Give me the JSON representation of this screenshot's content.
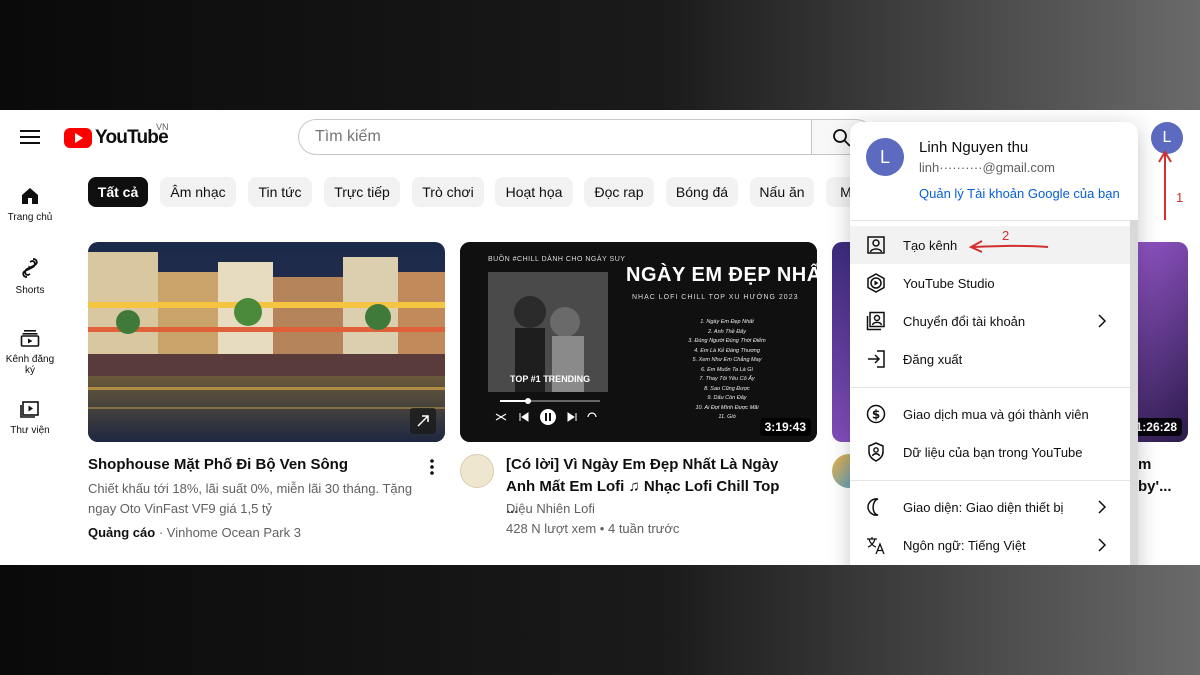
{
  "header": {
    "logo_text": "YouTube",
    "region": "VN",
    "search_placeholder": "Tìm kiếm",
    "avatar_letter": "L"
  },
  "sidebar": {
    "items": [
      {
        "label": "Trang chủ",
        "icon": "home-icon"
      },
      {
        "label": "Shorts",
        "icon": "shorts-icon"
      },
      {
        "label": "Kênh đăng ký",
        "icon": "subscriptions-icon"
      },
      {
        "label": "Thư viện",
        "icon": "library-icon"
      }
    ]
  },
  "chips": [
    "Tất cả",
    "Âm nhạc",
    "Tin tức",
    "Trực tiếp",
    "Trò chơi",
    "Hoạt họa",
    "Đọc rap",
    "Bóng đá",
    "Nấu ăn",
    "M"
  ],
  "videos": [
    {
      "title": "Shophouse Mặt Phố Đi Bộ Ven Sông",
      "desc": "Chiết khấu tới 18%, lãi suất 0%, miễn lãi 30 tháng. Tặng ngay Oto VinFast VF9 giá 1,5 tỷ",
      "ad_label": "Quảng cáo",
      "channel": "Vinhome Ocean Park 3"
    },
    {
      "title": "[Có lời] Vì Ngày Em Đẹp Nhất Là Ngày Anh Mất Em Lofi ♫ Nhạc Lofi Chill Top ...",
      "channel": "Diệu Nhiên Lofi",
      "meta": "428 N lượt xem • 4 tuần trước",
      "duration": "3:19:43",
      "thumb": {
        "caption": "BUỒN #CHILL DÀNH CHO NGÀY SUY",
        "headline": "NGÀY EM ĐẸP NHẤT",
        "subline": "NHẠC LOFI CHILL TOP XU HƯỚNG 2023",
        "badge": "TOP #1 TRENDING",
        "tracklist": [
          "1. Ngày Em Đẹp Nhất",
          "2. Anh Thề Đấy",
          "3. Đúng Người Đúng Thời Điểm",
          "4. Em Là Kẻ Đáng Thương",
          "5. Xem Như Em Chẳng May",
          "6. Em Muốn Ta Là Gì",
          "7. Thay Tôi Yêu Cô Ấy",
          "8. Sao Cũng Được",
          "9. Dấu Còn Đây",
          "10. Ai Đợi Mình Được Mãi",
          "11. Gió"
        ]
      }
    },
    {
      "title_fragment": "m",
      "meta_fragment": "by'...",
      "duration": "1:26:28"
    }
  ],
  "dropdown": {
    "name": "Linh Nguyen thu",
    "email": "linh··········@gmail.com",
    "manage_link": "Quản lý Tài khoản Google của bạn",
    "avatar_letter": "L",
    "items": [
      {
        "label": "Tạo kênh",
        "icon": "create-channel-icon"
      },
      {
        "label": "YouTube Studio",
        "icon": "studio-icon"
      },
      {
        "label": "Chuyển đổi tài khoản",
        "icon": "switch-account-icon"
      },
      {
        "label": "Đăng xuất",
        "icon": "sign-out-icon"
      },
      {
        "label": "Giao dịch mua và gói thành viên",
        "icon": "purchases-icon"
      },
      {
        "label": "Dữ liệu của bạn trong YouTube",
        "icon": "your-data-icon"
      },
      {
        "label": "Giao diện: Giao diện thiết bị",
        "icon": "appearance-icon"
      },
      {
        "label": "Ngôn ngữ: Tiếng Việt",
        "icon": "language-icon"
      }
    ]
  },
  "annotations": {
    "step1": "1",
    "step2": "2",
    "color": "#d32f2f"
  },
  "colors": {
    "brand_red": "#ff0000",
    "avatar": "#5c6bc0",
    "link_blue": "#065fd4"
  }
}
